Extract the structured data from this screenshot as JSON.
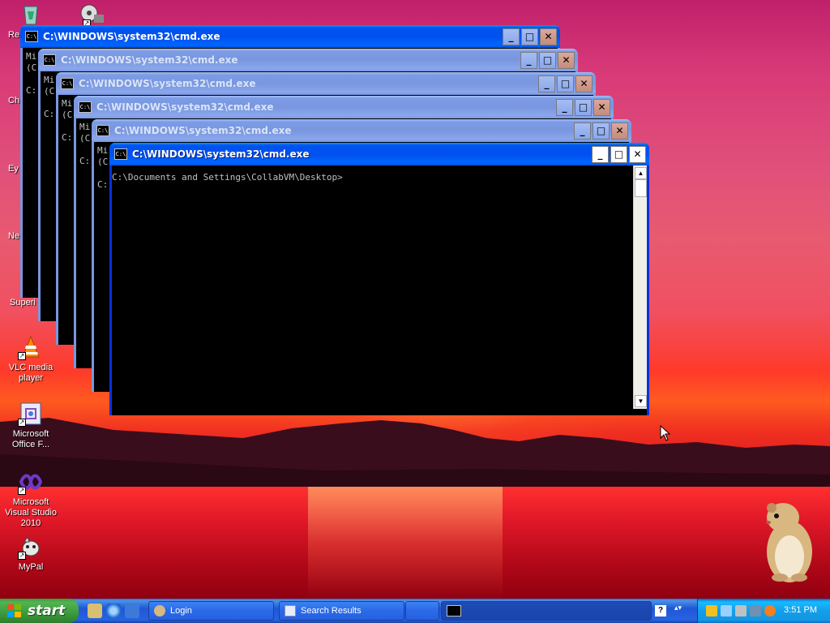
{
  "desktop": {
    "icons": [
      {
        "label": "Re",
        "icon": "recycle-bin-icon"
      },
      {
        "label": "",
        "icon": "movie-maker-icon"
      },
      {
        "label": "Ch",
        "icon": "chrome-icon"
      },
      {
        "label": "Ey",
        "icon": "app-icon"
      },
      {
        "label": "Ne",
        "icon": "network-icon"
      },
      {
        "label": "Superi",
        "icon": "app-icon"
      },
      {
        "label": "VLC media player",
        "icon": "vlc-icon"
      },
      {
        "label": "Microsoft Office F...",
        "icon": "office-icon"
      },
      {
        "label": "Microsoft Visual Studio 2010",
        "icon": "visual-studio-icon"
      },
      {
        "label": "MyPal",
        "icon": "mypal-icon"
      }
    ]
  },
  "windows": [
    {
      "title": "C:\\WINDOWS\\system32\\cmd.exe",
      "console_peek": "Mi\n(C\n\nC:"
    },
    {
      "title": "C:\\WINDOWS\\system32\\cmd.exe",
      "console_peek": "Mi\n(C\n\nC:"
    },
    {
      "title": "C:\\WINDOWS\\system32\\cmd.exe",
      "console_peek": "Mi\n(C\n\nC:"
    },
    {
      "title": "C:\\WINDOWS\\system32\\cmd.exe",
      "console_peek": "Mi\n(C\n\nC:"
    },
    {
      "title": "C:\\WINDOWS\\system32\\cmd.exe",
      "console_peek": "Mi\n(C\n\nC:"
    },
    {
      "title": "C:\\WINDOWS\\system32\\cmd.exe",
      "console_text": "C:\\Documents and Settings\\CollabVM\\Desktop>"
    }
  ],
  "title_buttons": {
    "minimize": "_",
    "maximize": "□",
    "close": "✕"
  },
  "console_icon_text": "C:\\",
  "taskbar": {
    "start_label": "start",
    "buttons": [
      {
        "label": "Login",
        "icon": "app-icon"
      },
      {
        "label": "Search Results",
        "icon": "search-results-icon"
      },
      {
        "label": "",
        "icon": "blank"
      },
      {
        "label": "",
        "icon": "cmd-icon"
      }
    ],
    "clock": "3:51 PM"
  },
  "colors": {
    "xp_blue": "#0831d9",
    "start_green": "#3c9a3c",
    "console_bg": "#000000"
  }
}
